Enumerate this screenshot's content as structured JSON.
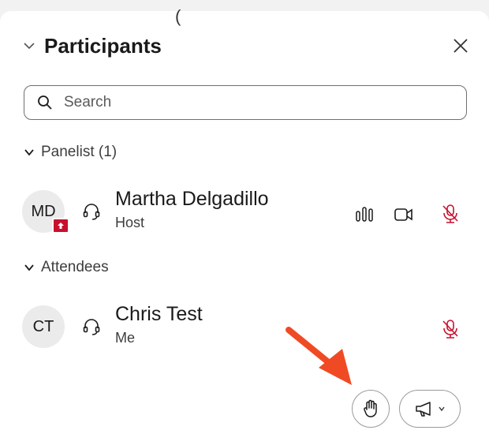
{
  "panel": {
    "top_mark": "(",
    "title": "Participants"
  },
  "search": {
    "placeholder": "Search"
  },
  "sections": {
    "panelists_label": "Panelist (1)",
    "attendees_label": "Attendees"
  },
  "panelists": [
    {
      "initials": "MD",
      "name": "Martha Delgadillo",
      "role": "Host"
    }
  ],
  "attendees": [
    {
      "initials": "CT",
      "name": "Chris Test",
      "role": "Me"
    }
  ],
  "icons": {
    "collapse": "chevron-down-icon",
    "close": "close-icon",
    "search": "search-icon",
    "audio": "headset-icon",
    "audio_level": "audio-level-icon",
    "video": "video-camera-icon",
    "muted": "muted-microphone-icon",
    "raise_hand": "raise-hand-icon",
    "announce": "megaphone-icon",
    "annotation": "red-arrow-icon"
  },
  "colors": {
    "muted_red": "#c8102e",
    "annotation_arrow": "#f04a24",
    "badge": "#c8102e"
  }
}
